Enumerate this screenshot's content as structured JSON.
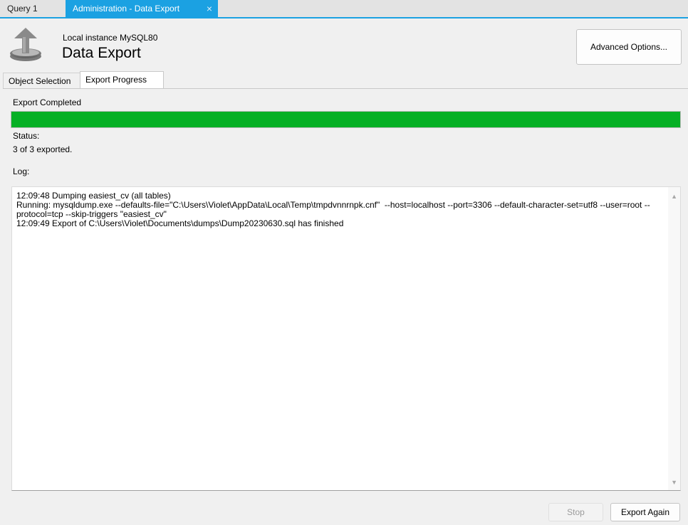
{
  "doc_tabs": {
    "query": "Query 1",
    "admin": "Administration - Data Export",
    "close_glyph": "×"
  },
  "header": {
    "instance": "Local instance MySQL80",
    "title": "Data Export",
    "icon": "export-icon",
    "advanced_options": "Advanced Options..."
  },
  "sub_tabs": {
    "object_selection": "Object Selection",
    "export_progress": "Export Progress"
  },
  "progress": {
    "label": "Export Completed",
    "fraction": 1.0,
    "color": "#06b025"
  },
  "status": {
    "label": "Status:",
    "text": "3 of 3 exported."
  },
  "log": {
    "label": "Log:",
    "lines": [
      "12:09:48 Dumping easiest_cv (all tables)",
      "Running: mysqldump.exe --defaults-file=\"C:\\Users\\Violet\\AppData\\Local\\Temp\\tmpdvnnrnpk.cnf\"  --host=localhost --port=3306 --default-character-set=utf8 --user=root --protocol=tcp --skip-triggers \"easiest_cv\"",
      "12:09:49 Export of C:\\Users\\Violet\\Documents\\dumps\\Dump20230630.sql has finished"
    ],
    "scroll_up": "▲",
    "scroll_down": "▼"
  },
  "buttons": {
    "stop": "Stop",
    "export_again": "Export Again"
  },
  "colors": {
    "accent": "#1ba1e2"
  }
}
